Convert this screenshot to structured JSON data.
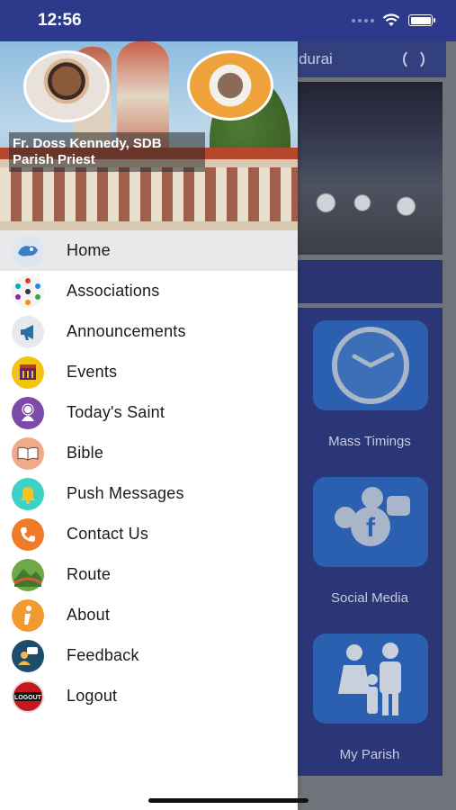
{
  "status_bar": {
    "time": "12:56"
  },
  "background": {
    "header_title": "durai",
    "tiles": [
      {
        "label": "Mass Timings",
        "icon": "clock-icon"
      },
      {
        "label": "Social Media",
        "icon": "social-media-icon"
      },
      {
        "label": "My Parish",
        "icon": "family-icon"
      }
    ]
  },
  "drawer": {
    "header": {
      "name": "Fr. Doss Kennedy, SDB",
      "role": "Parish Priest"
    },
    "menu": [
      {
        "label": "Home",
        "icon": "home-icon",
        "color": "#dfe6ef",
        "active": true
      },
      {
        "label": "Associations",
        "icon": "people-network-icon",
        "color": "#f4f4f4"
      },
      {
        "label": "Announcements",
        "icon": "megaphone-icon",
        "color": "#e6e9ee"
      },
      {
        "label": "Events",
        "icon": "calendar-icon",
        "color": "#f2c40f"
      },
      {
        "label": "Today's Saint",
        "icon": "saint-icon",
        "color": "#7e4aa8"
      },
      {
        "label": "Bible",
        "icon": "book-icon",
        "color": "#f1a98a"
      },
      {
        "label": "Push Messages",
        "icon": "bell-icon",
        "color": "#3fd0c8"
      },
      {
        "label": "Contact Us",
        "icon": "phone-icon",
        "color": "#f07a28"
      },
      {
        "label": "Route",
        "icon": "map-icon",
        "color": "#6fa84a"
      },
      {
        "label": "About",
        "icon": "info-icon",
        "color": "#f29a2e"
      },
      {
        "label": "Feedback",
        "icon": "feedback-icon",
        "color": "#1e4d6b"
      },
      {
        "label": "Logout",
        "icon": "logout-icon",
        "color": "#c8181e"
      }
    ]
  }
}
